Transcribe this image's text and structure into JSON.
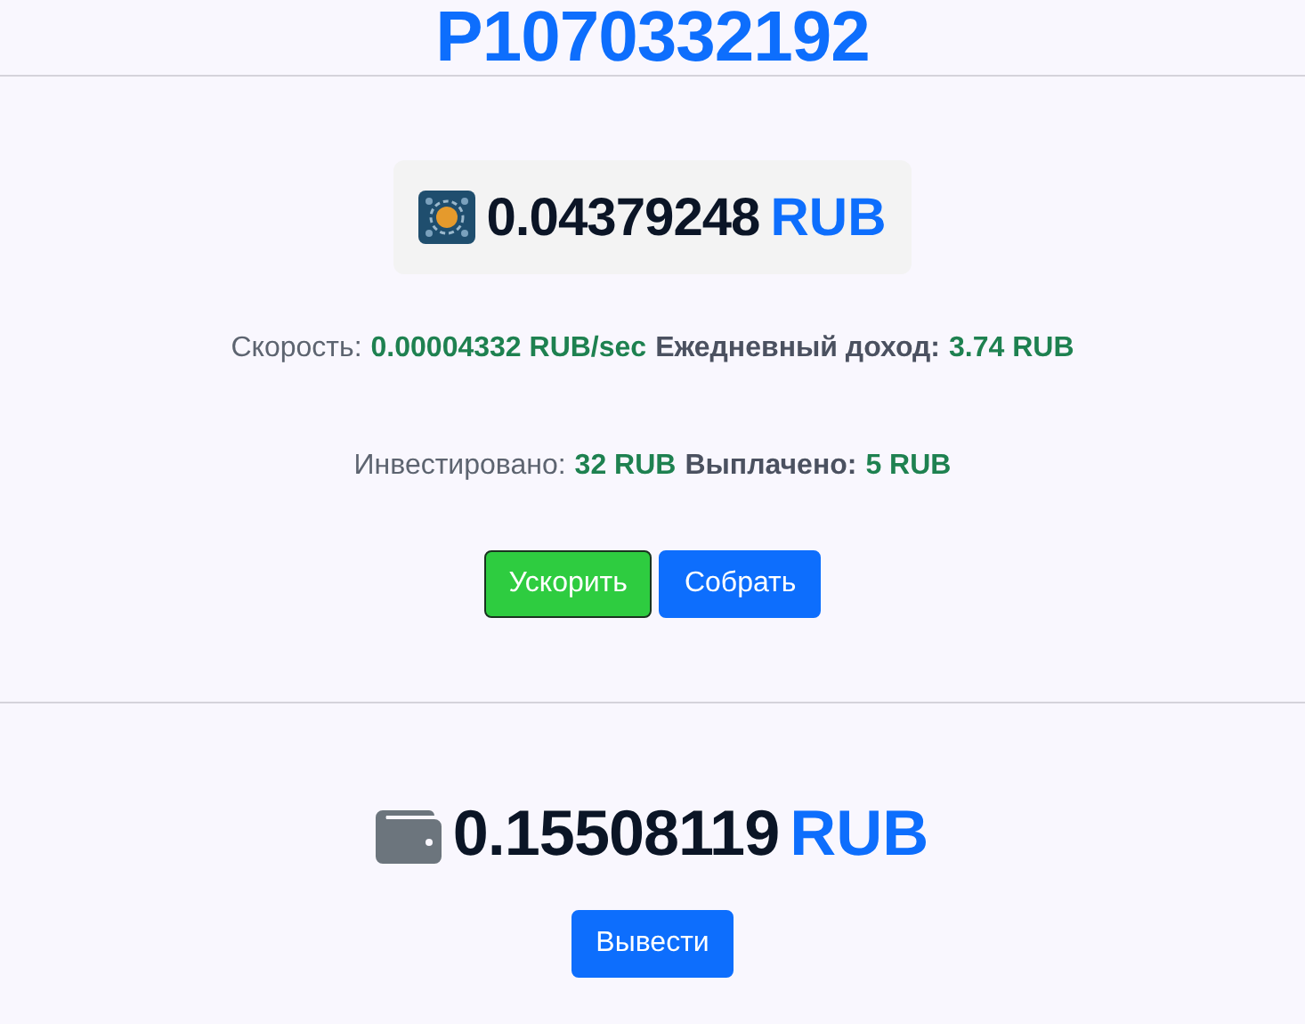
{
  "account_id": "P1070332192",
  "miner": {
    "balance": "0.04379248",
    "currency": "RUB",
    "stats": [
      [
        {
          "kind": "label",
          "text": "Скорость:"
        },
        {
          "kind": "value",
          "text": "0.00004332 RUB/sec"
        },
        {
          "kind": "strong-label",
          "text": "Ежедневный доход:"
        },
        {
          "kind": "value",
          "text": "3.74 RUB"
        }
      ],
      [
        {
          "kind": "label",
          "text": "Инвестировано:"
        },
        {
          "kind": "value",
          "text": "32 RUB"
        },
        {
          "kind": "strong-label",
          "text": "Выплачено:"
        },
        {
          "kind": "value",
          "text": "5 RUB"
        }
      ]
    ],
    "buttons": [
      {
        "kind": "success",
        "label": "Ускорить"
      },
      {
        "kind": "primary",
        "label": "Собрать"
      }
    ]
  },
  "wallet": {
    "balance": "0.15508119",
    "currency": "RUB",
    "buttons": [
      {
        "kind": "primary",
        "label": "Вывести"
      }
    ]
  }
}
